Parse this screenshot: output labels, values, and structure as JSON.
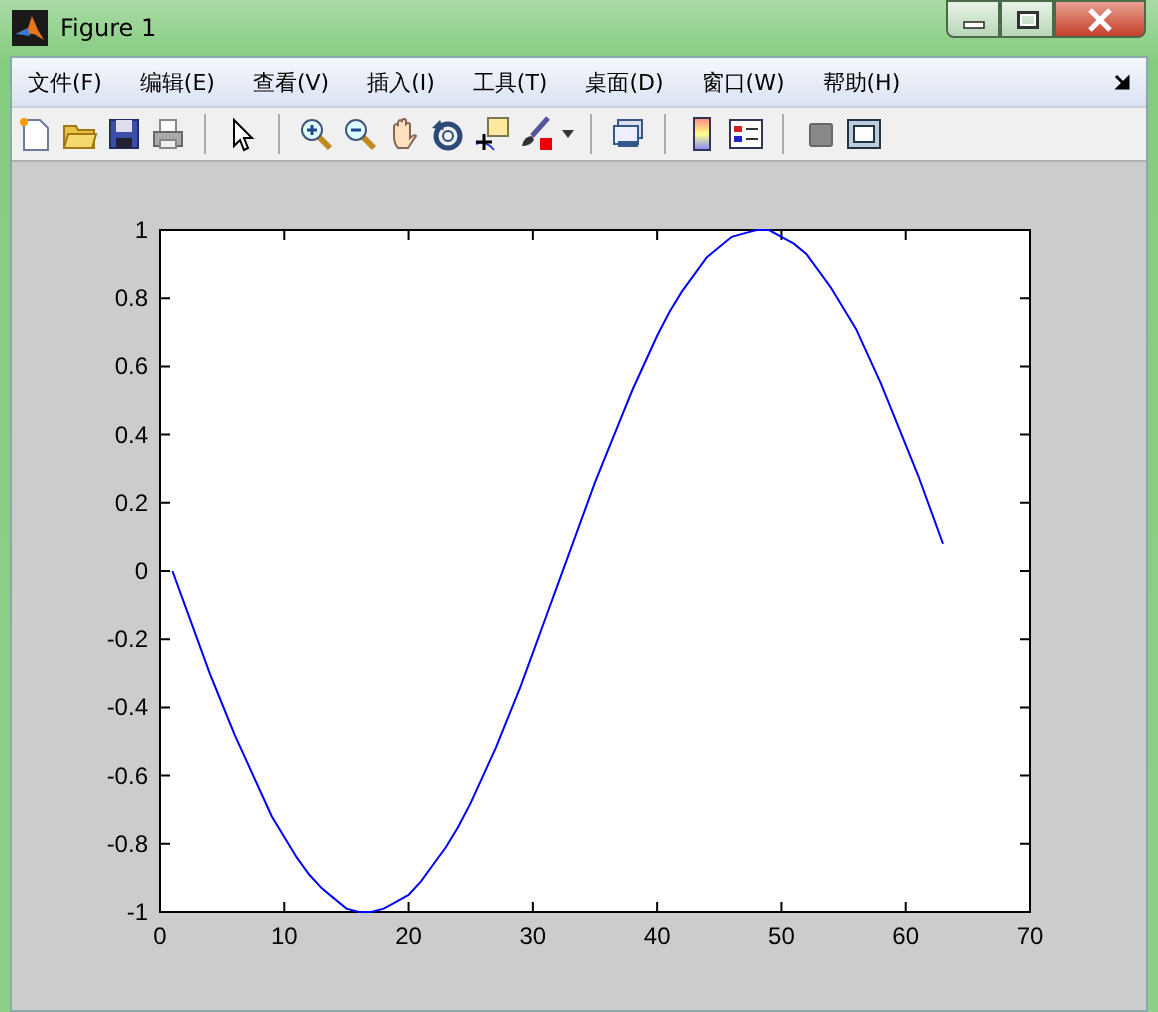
{
  "window": {
    "title": "Figure 1"
  },
  "menu": [
    "文件(F)",
    "编辑(E)",
    "查看(V)",
    "插入(I)",
    "工具(T)",
    "桌面(D)",
    "窗口(W)",
    "帮助(H)"
  ],
  "axes": {
    "chart_data": {
      "type": "line",
      "x": [
        1,
        2,
        3,
        4,
        5,
        6,
        7,
        8,
        9,
        10,
        11,
        12,
        13,
        14,
        15,
        16,
        17,
        18,
        19,
        20,
        21,
        22,
        23,
        24,
        25,
        26,
        27,
        28,
        29,
        30,
        31,
        32,
        33,
        34,
        35,
        36,
        37,
        38,
        39,
        40,
        41,
        42,
        43,
        44,
        45,
        46,
        47,
        48,
        49,
        50,
        51,
        52,
        53,
        54,
        55,
        56,
        57,
        58,
        59,
        60,
        61,
        62,
        63
      ],
      "series": [
        {
          "color": "#0000ff",
          "values": [
            0,
            -0.1,
            -0.2,
            -0.3,
            -0.39,
            -0.48,
            -0.56,
            -0.64,
            -0.72,
            -0.78,
            -0.84,
            -0.89,
            -0.93,
            -0.96,
            -0.99,
            -1,
            -1,
            -0.99,
            -0.97,
            -0.95,
            -0.91,
            -0.86,
            -0.81,
            -0.75,
            -0.68,
            -0.6,
            -0.52,
            -0.43,
            -0.34,
            -0.24,
            -0.14,
            -0.04,
            0.06,
            0.16,
            0.26,
            0.35,
            0.44,
            0.53,
            0.61,
            0.69,
            0.76,
            0.82,
            0.87,
            0.92,
            0.95,
            0.98,
            0.99,
            1,
            1,
            0.98,
            0.96,
            0.93,
            0.88,
            0.83,
            0.77,
            0.71,
            0.63,
            0.55,
            0.46,
            0.37,
            0.28,
            0.18,
            0.08
          ]
        }
      ],
      "xlim": [
        0,
        70
      ],
      "ylim": [
        -1,
        1
      ],
      "xticks": [
        0,
        10,
        20,
        30,
        40,
        50,
        60,
        70
      ],
      "yticks": [
        -1,
        -0.8,
        -0.6,
        -0.4,
        -0.2,
        0,
        0.2,
        0.4,
        0.6,
        0.8,
        1
      ]
    }
  }
}
